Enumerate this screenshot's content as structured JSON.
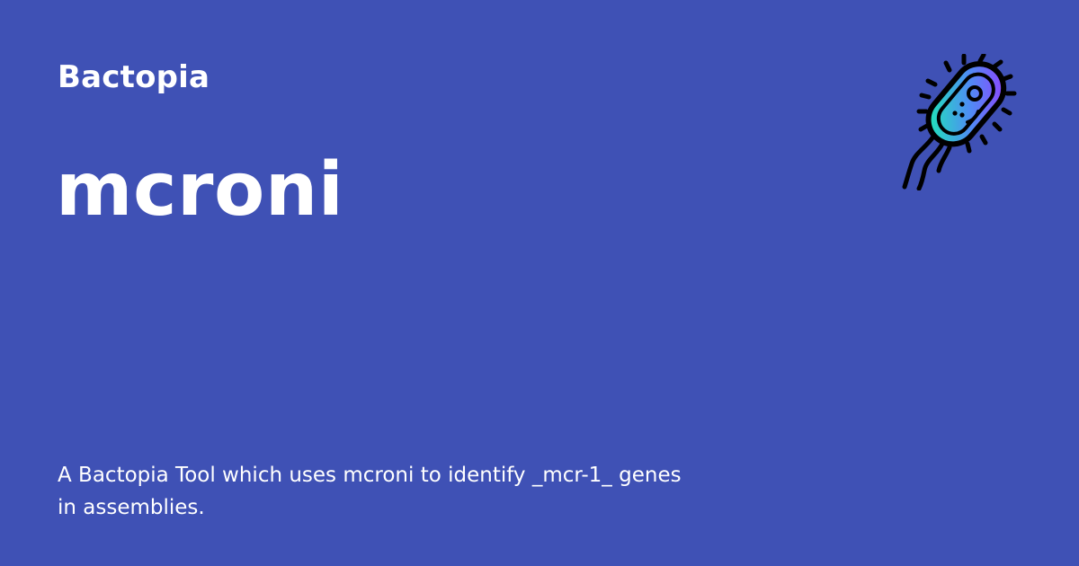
{
  "card": {
    "site_name": "Bactopia",
    "title": "mcroni",
    "description": "A Bactopia Tool which uses mcroni to identify _mcr-1_ genes in assemblies.",
    "logo_icon": "bacterium-icon"
  },
  "colors": {
    "background": "#3f51b5",
    "text": "#ffffff",
    "logo_gradient_top": "#7c4dff",
    "logo_gradient_bottom": "#1de9b6",
    "logo_outline": "#000000"
  }
}
